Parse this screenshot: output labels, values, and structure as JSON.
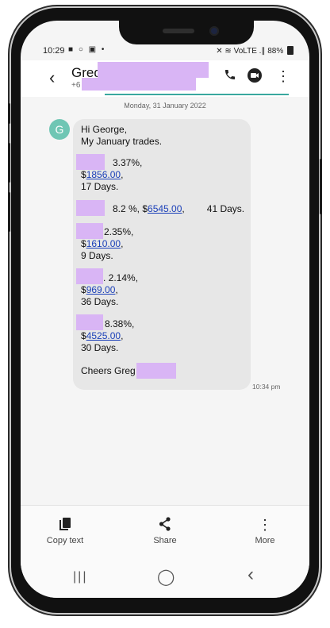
{
  "status": {
    "time": "10:29",
    "left_icons": "■ ○ ▣ •",
    "right_icons": "✕ ≋ VoLTE .∥",
    "battery": "88%"
  },
  "header": {
    "back_glyph": "‹",
    "contact_name": "Greg",
    "contact_number_prefix": "+6",
    "call_icon": "phone-icon",
    "video_icon": "video-icon",
    "more_icon": "more-vertical-icon"
  },
  "chat": {
    "date": "Monday, 31 January 2022",
    "avatar_letter": "G",
    "message": {
      "line1": "Hi George,",
      "line2": " My January trades.",
      "t1_pct": "3.37%,",
      "t1_amt_prefix": "$",
      "t1_amt": "1856.00",
      "t1_amt_suffix": ",",
      "t1_days": "17 Days.",
      "t2_pct": "8.2 %, $",
      "t2_amt": "6545.00",
      "t2_suffix": ",",
      "t2_days": "41 Days.",
      "t3_pct": "2.35%,",
      "t3_amt_prefix": "$",
      "t3_amt": "1610.00",
      "t3_amt_suffix": ",",
      "t3_days": "9 Days.",
      "t4_pct": ". 2.14%,",
      "t4_amt_prefix": "$",
      "t4_amt": "969.00",
      "t4_amt_suffix": ",",
      "t4_days": "36 Days.",
      "t5_pct": "8.38%,",
      "t5_amt_prefix": "$",
      "t5_amt": "4525.00",
      "t5_amt_suffix": ",",
      "t5_days": "30 Days.",
      "signoff": "Cheers Greg"
    },
    "timestamp": "10:34 pm"
  },
  "actions": [
    {
      "label": "Copy text",
      "icon": "copy-icon",
      "glyph": "❐"
    },
    {
      "label": "Share",
      "icon": "share-icon",
      "glyph": "⫘"
    },
    {
      "label": "More",
      "icon": "more-vertical-icon",
      "glyph": "⋮"
    }
  ],
  "nav": {
    "recents_glyph": "|||",
    "home_glyph": "◯",
    "back_glyph": "‹"
  },
  "colors": {
    "avatar": "#6fc6b4",
    "link": "#1a3fb8",
    "redaction": "#d9b5f5",
    "accent_line": "#3aa89f"
  }
}
